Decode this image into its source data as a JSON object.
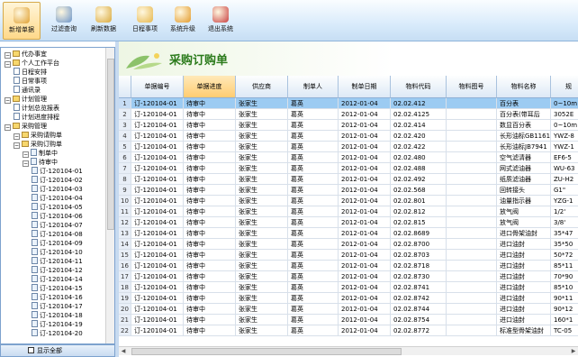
{
  "toolbar": {
    "buttons": [
      {
        "label": "新增单据",
        "icon": "tools-icon",
        "color": "#e0a030"
      },
      {
        "label": "过滤查询",
        "icon": "magnifier-icon",
        "color": "#6a93c8"
      },
      {
        "label": "刷新数据",
        "icon": "refresh-coins-icon",
        "color": "#d9a83a"
      },
      {
        "label": "日程事项",
        "icon": "clock-icon",
        "color": "#e6b64a"
      },
      {
        "label": "系统升级",
        "icon": "gear-icon",
        "color": "#e39a2a"
      },
      {
        "label": "退出系统",
        "icon": "exit-icon",
        "color": "#c94040"
      }
    ]
  },
  "sidebar": {
    "tree": [
      {
        "label": "代办事宜",
        "level": 0,
        "kind": "folder"
      },
      {
        "label": "个人工作平台",
        "level": 0,
        "kind": "folder"
      },
      {
        "label": "日程安排",
        "level": 1,
        "kind": "doc"
      },
      {
        "label": "日常事项",
        "level": 1,
        "kind": "doc"
      },
      {
        "label": "通讯录",
        "level": 1,
        "kind": "doc"
      },
      {
        "label": "计划管理",
        "level": 0,
        "kind": "folder"
      },
      {
        "label": "计划总览报表",
        "level": 1,
        "kind": "doc"
      },
      {
        "label": "计划进度排程",
        "level": 1,
        "kind": "doc"
      },
      {
        "label": "采购管理",
        "level": 0,
        "kind": "folder"
      },
      {
        "label": "采购请购单",
        "level": 1,
        "kind": "folder"
      },
      {
        "label": "采购订购单",
        "level": 1,
        "kind": "folder"
      },
      {
        "label": "制单中",
        "level": 2,
        "kind": "check"
      },
      {
        "label": "待审中",
        "level": 2,
        "kind": "check"
      },
      {
        "label": "订-120104-01",
        "level": 3,
        "kind": "leaf"
      },
      {
        "label": "订-120104-02",
        "level": 3,
        "kind": "leaf"
      },
      {
        "label": "订-120104-03",
        "level": 3,
        "kind": "leaf"
      },
      {
        "label": "订-120104-04",
        "level": 3,
        "kind": "leaf"
      },
      {
        "label": "订-120104-05",
        "level": 3,
        "kind": "leaf"
      },
      {
        "label": "订-120104-06",
        "level": 3,
        "kind": "leaf"
      },
      {
        "label": "订-120104-07",
        "level": 3,
        "kind": "leaf"
      },
      {
        "label": "订-120104-08",
        "level": 3,
        "kind": "leaf"
      },
      {
        "label": "订-120104-09",
        "level": 3,
        "kind": "leaf"
      },
      {
        "label": "订-120104-10",
        "level": 3,
        "kind": "leaf"
      },
      {
        "label": "订-120104-11",
        "level": 3,
        "kind": "leaf"
      },
      {
        "label": "订-120104-12",
        "level": 3,
        "kind": "leaf"
      },
      {
        "label": "订-120104-14",
        "level": 3,
        "kind": "leaf"
      },
      {
        "label": "订-120104-15",
        "level": 3,
        "kind": "leaf"
      },
      {
        "label": "订-120104-16",
        "level": 3,
        "kind": "leaf"
      },
      {
        "label": "订-120104-17",
        "level": 3,
        "kind": "leaf"
      },
      {
        "label": "订-120104-18",
        "level": 3,
        "kind": "leaf"
      },
      {
        "label": "订-120104-19",
        "level": 3,
        "kind": "leaf"
      },
      {
        "label": "订-120104-20",
        "level": 3,
        "kind": "leaf"
      }
    ],
    "footer_label": "显示全部"
  },
  "page": {
    "title": "采购订购单"
  },
  "grid": {
    "headers": [
      "",
      "单据编号",
      "单据进度",
      "供应商",
      "制单人",
      "制单日期",
      "物料代码",
      "物料图号",
      "物料名称",
      "规"
    ],
    "selected_header": 2,
    "rows": [
      [
        "1",
        "订-120104-01",
        "待审中",
        "张家生",
        "葛英",
        "2012-01-04",
        "02.02.412",
        "",
        "百分表",
        "0~10m"
      ],
      [
        "2",
        "订-120104-01",
        "待审中",
        "张家生",
        "葛英",
        "2012-01-04",
        "02.02.4125",
        "",
        "百分表(带耳后",
        "3052E"
      ],
      [
        "3",
        "订-120104-01",
        "待审中",
        "张家生",
        "葛英",
        "2012-01-04",
        "02.02.414",
        "",
        "数显百分表",
        "0~10m"
      ],
      [
        "4",
        "订-120104-01",
        "待审中",
        "张家生",
        "葛英",
        "2012-01-04",
        "02.02.420",
        "",
        "长形油标GB1161",
        "YWZ-8"
      ],
      [
        "5",
        "订-120104-01",
        "待审中",
        "张家生",
        "葛英",
        "2012-01-04",
        "02.02.422",
        "",
        "长形油标JB7941",
        "YWZ-1"
      ],
      [
        "6",
        "订-120104-01",
        "待审中",
        "张家生",
        "葛英",
        "2012-01-04",
        "02.02.480",
        "",
        "空气滤清器",
        "EF6-5"
      ],
      [
        "7",
        "订-120104-01",
        "待审中",
        "张家生",
        "葛英",
        "2012-01-04",
        "02.02.488",
        "",
        "网式滤油器",
        "WU-63"
      ],
      [
        "8",
        "订-120104-01",
        "待审中",
        "张家生",
        "葛英",
        "2012-01-04",
        "02.02.492",
        "",
        "纸质滤油器",
        "ZU-H2"
      ],
      [
        "9",
        "订-120104-01",
        "待审中",
        "张家生",
        "葛英",
        "2012-01-04",
        "02.02.568",
        "",
        "回转接头",
        "G1\""
      ],
      [
        "10",
        "订-120104-01",
        "待审中",
        "张家生",
        "葛英",
        "2012-01-04",
        "02.02.801",
        "",
        "油量指示器",
        "YZG-1"
      ],
      [
        "11",
        "订-120104-01",
        "待审中",
        "张家生",
        "葛英",
        "2012-01-04",
        "02.02.812",
        "",
        "放气阀",
        "1/2'"
      ],
      [
        "12",
        "订-120104-01",
        "待审中",
        "张家生",
        "葛英",
        "2012-01-04",
        "02.02.815",
        "",
        "放气阀",
        "3/8'"
      ],
      [
        "13",
        "订-120104-01",
        "待审中",
        "张家生",
        "葛英",
        "2012-01-04",
        "02.02.8689",
        "",
        "进口骨架油封",
        "35*47"
      ],
      [
        "14",
        "订-120104-01",
        "待审中",
        "张家生",
        "葛英",
        "2012-01-04",
        "02.02.8700",
        "",
        "进口油封",
        "35*50"
      ],
      [
        "15",
        "订-120104-01",
        "待审中",
        "张家生",
        "葛英",
        "2012-01-04",
        "02.02.8703",
        "",
        "进口油封",
        "50*72"
      ],
      [
        "16",
        "订-120104-01",
        "待审中",
        "张家生",
        "葛英",
        "2012-01-04",
        "02.02.8718",
        "",
        "进口油封",
        "85*11"
      ],
      [
        "17",
        "订-120104-01",
        "待审中",
        "张家生",
        "葛英",
        "2012-01-04",
        "02.02.8730",
        "",
        "进口油封",
        "70*90"
      ],
      [
        "18",
        "订-120104-01",
        "待审中",
        "张家生",
        "葛英",
        "2012-01-04",
        "02.02.8741",
        "",
        "进口油封",
        "85*10"
      ],
      [
        "19",
        "订-120104-01",
        "待审中",
        "张家生",
        "葛英",
        "2012-01-04",
        "02.02.8742",
        "",
        "进口油封",
        "90*11"
      ],
      [
        "20",
        "订-120104-01",
        "待审中",
        "张家生",
        "葛英",
        "2012-01-04",
        "02.02.8744",
        "",
        "进口油封",
        "90*12"
      ],
      [
        "21",
        "订-120104-01",
        "待审中",
        "张家生",
        "葛英",
        "2012-01-04",
        "02.02.8754",
        "",
        "进口油封",
        "160*1"
      ],
      [
        "22",
        "订-120104-01",
        "待审中",
        "张家生",
        "葛英",
        "2012-01-04",
        "02.02.8772",
        "",
        "标准型骨架油封",
        "TC-05"
      ]
    ],
    "selected_row": 0
  }
}
